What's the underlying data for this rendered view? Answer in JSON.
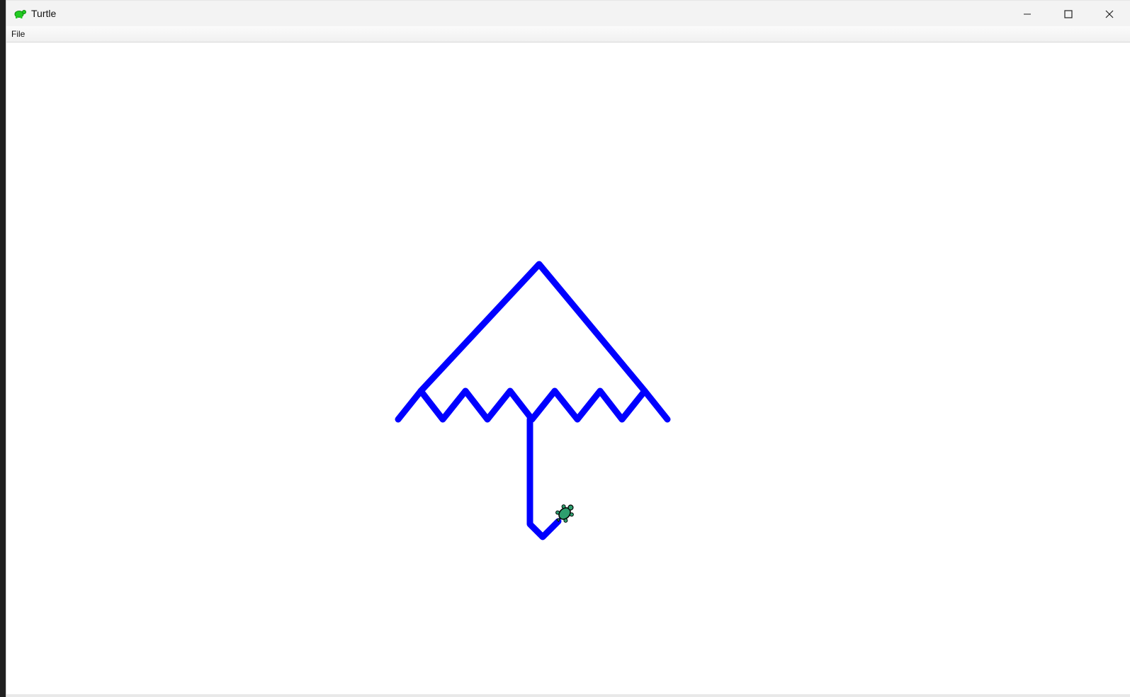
{
  "window": {
    "title": "Turtle",
    "icon": "turtle-icon",
    "controls": [
      "minimize-icon",
      "maximize-icon",
      "close-icon"
    ]
  },
  "menubar": {
    "items": [
      {
        "label": "File"
      }
    ]
  },
  "canvas": {
    "background": "#ffffff",
    "pen_color": "#0000ff",
    "turtle_fill": "#2e9e6e",
    "turtle_icon": "turtle-icon"
  }
}
